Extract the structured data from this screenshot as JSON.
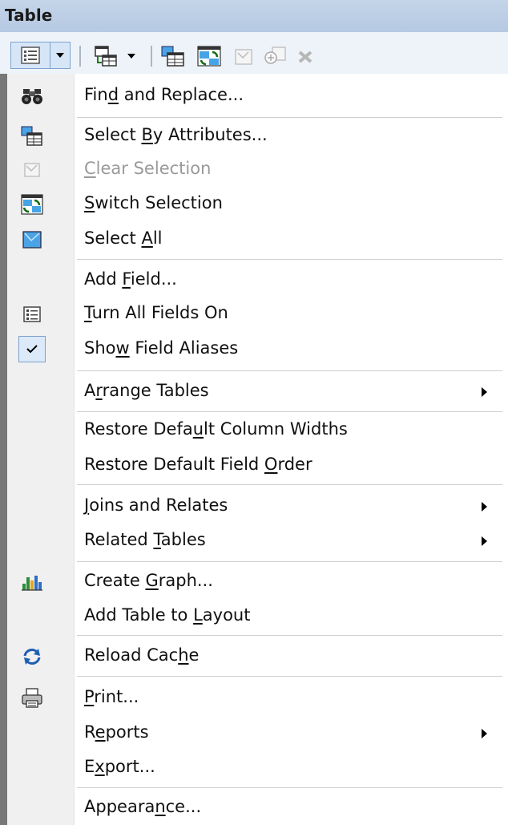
{
  "window": {
    "title": "Table"
  },
  "toolbar": {
    "buttons": [
      {
        "name": "table-options",
        "icon": "table-options-icon"
      },
      {
        "name": "table-options-dropdown",
        "icon": "chevron-down-icon"
      },
      {
        "name": "related-tables",
        "icon": "related-tables-icon"
      },
      {
        "name": "related-tables-dropdown",
        "icon": "chevron-down-icon"
      },
      {
        "name": "select-by-attributes",
        "icon": "select-by-attributes-icon"
      },
      {
        "name": "switch-selection",
        "icon": "switch-selection-icon"
      },
      {
        "name": "clear-selection",
        "icon": "clear-selection-icon",
        "enabled": false
      },
      {
        "name": "zoom-to-selected",
        "icon": "zoom-to-selected-icon",
        "enabled": false
      },
      {
        "name": "delete-selected",
        "icon": "delete-icon",
        "enabled": false
      }
    ]
  },
  "menu": {
    "items": [
      {
        "label": "Find and Replace...",
        "before": "Fin",
        "mnemonic": "d",
        "after": " and Replace...",
        "icon": "binoculars-icon",
        "enabled": true
      },
      {
        "label": "Select By Attributes...",
        "before": "Select ",
        "mnemonic": "B",
        "after": "y Attributes...",
        "icon": "select-by-attributes-icon",
        "enabled": true
      },
      {
        "label": "Clear Selection",
        "before": "",
        "mnemonic": "C",
        "after": "lear Selection",
        "icon": "clear-selection-icon",
        "enabled": false
      },
      {
        "label": "Switch Selection",
        "before": "",
        "mnemonic": "S",
        "after": "witch Selection",
        "icon": "switch-selection-icon",
        "enabled": true
      },
      {
        "label": "Select All",
        "before": "Select ",
        "mnemonic": "A",
        "after": "ll",
        "icon": "select-all-icon",
        "enabled": true
      },
      {
        "label": "Add Field...",
        "before": "Add ",
        "mnemonic": "F",
        "after": "ield...",
        "icon": "",
        "enabled": true
      },
      {
        "label": "Turn All Fields On",
        "before": "",
        "mnemonic": "T",
        "after": "urn All Fields On",
        "icon": "fields-list-icon",
        "enabled": true
      },
      {
        "label": "Show Field Aliases",
        "before": "Sho",
        "mnemonic": "w",
        "after": " Field Aliases",
        "icon": "checkmark-icon",
        "checked": true,
        "enabled": true
      },
      {
        "label": "Arrange Tables",
        "before": "A",
        "mnemonic": "r",
        "after": "range Tables",
        "icon": "",
        "submenu": true,
        "enabled": true
      },
      {
        "label": "Restore Default Column Widths",
        "before": "Restore Defa",
        "mnemonic": "u",
        "after": "lt Column Widths",
        "icon": "",
        "enabled": true
      },
      {
        "label": "Restore Default Field Order",
        "before": "Restore Default Field ",
        "mnemonic": "O",
        "after": "rder",
        "icon": "",
        "enabled": true
      },
      {
        "label": "Joins and Relates",
        "before": "",
        "mnemonic": "J",
        "after": "oins and Relates",
        "icon": "",
        "submenu": true,
        "enabled": true
      },
      {
        "label": "Related Tables",
        "before": "Related ",
        "mnemonic": "T",
        "after": "ables",
        "icon": "",
        "submenu": true,
        "enabled": true
      },
      {
        "label": "Create Graph...",
        "before": "Create ",
        "mnemonic": "G",
        "after": "raph...",
        "icon": "bar-chart-icon",
        "enabled": true
      },
      {
        "label": "Add Table to Layout",
        "before": "Add Table to ",
        "mnemonic": "L",
        "after": "ayout",
        "icon": "",
        "enabled": true
      },
      {
        "label": "Reload Cache",
        "before": "Reload Cac",
        "mnemonic": "h",
        "after": "e",
        "icon": "reload-icon",
        "enabled": true
      },
      {
        "label": "Print...",
        "before": "",
        "mnemonic": "P",
        "after": "rint...",
        "icon": "printer-icon",
        "enabled": true
      },
      {
        "label": "Reports",
        "before": "R",
        "mnemonic": "e",
        "after": "ports",
        "icon": "",
        "submenu": true,
        "enabled": true
      },
      {
        "label": "Export...",
        "before": "E",
        "mnemonic": "x",
        "after": "port...",
        "icon": "",
        "enabled": true
      },
      {
        "label": "Appearance...",
        "before": "Appeara",
        "mnemonic": "n",
        "after": "ce...",
        "icon": "",
        "enabled": true
      }
    ]
  }
}
